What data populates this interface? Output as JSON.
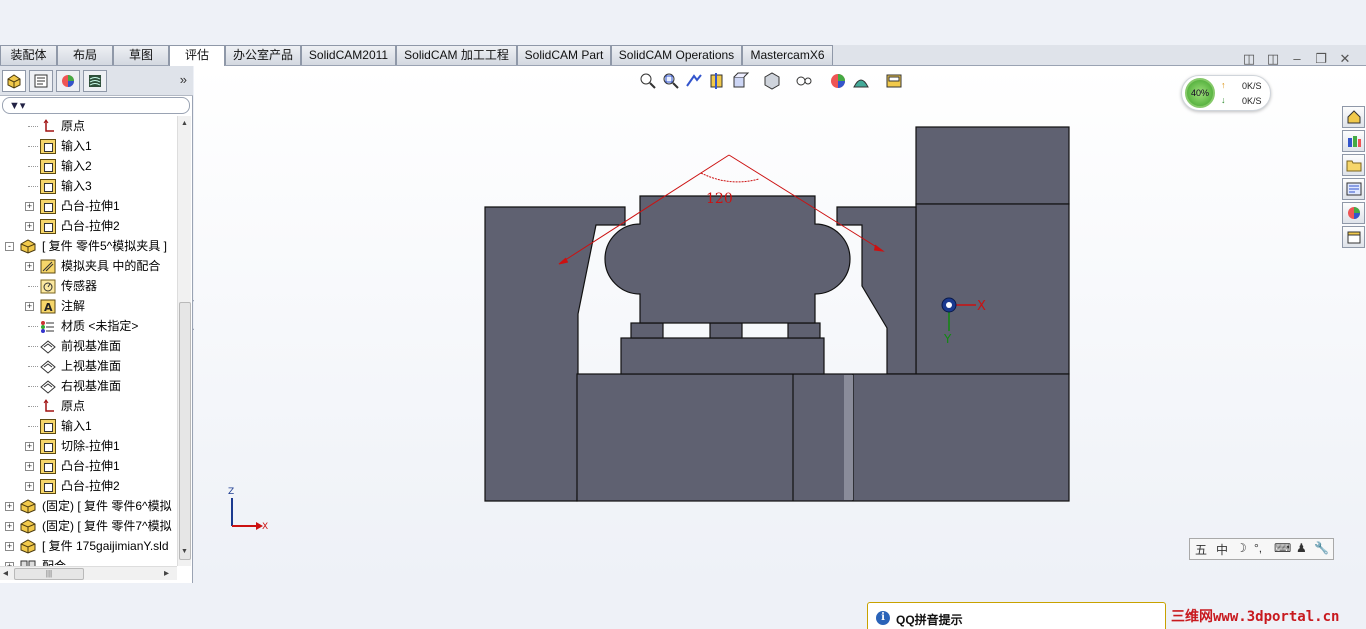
{
  "menu_tabs": [
    {
      "label": "装配体"
    },
    {
      "label": "布局"
    },
    {
      "label": "草图"
    },
    {
      "label": "评估"
    },
    {
      "label": "办公室产品"
    },
    {
      "label": "SolidCAM2011"
    },
    {
      "label": "SolidCAM 加工工程"
    },
    {
      "label": "SolidCAM Part"
    },
    {
      "label": "SolidCAM Operations"
    },
    {
      "label": "MastercamX6"
    }
  ],
  "active_tab": "评估",
  "tree": [
    {
      "label": "原点",
      "icon": "origin-icon",
      "level": 2
    },
    {
      "label": "输入1",
      "icon": "import-feature-icon",
      "level": 2
    },
    {
      "label": "输入2",
      "icon": "import-feature-icon",
      "level": 2
    },
    {
      "label": "输入3",
      "icon": "import-feature-icon",
      "level": 2
    },
    {
      "label": "凸台-拉伸1",
      "icon": "boss-extrude-icon",
      "level": 2,
      "expander": "+"
    },
    {
      "label": "凸台-拉伸2",
      "icon": "boss-extrude-icon",
      "level": 2,
      "expander": "+"
    },
    {
      "label": "[ 复件 零件5^模拟夹具 ]",
      "icon": "part-icon",
      "level": 1,
      "expander": "-"
    },
    {
      "label": "模拟夹具 中的配合",
      "icon": "mates-icon",
      "level": 2,
      "expander": "+"
    },
    {
      "label": "传感器",
      "icon": "sensor-icon",
      "level": 2
    },
    {
      "label": "注解",
      "icon": "annotation-icon",
      "level": 2,
      "expander": "+"
    },
    {
      "label": "材质 <未指定>",
      "icon": "material-icon",
      "level": 2
    },
    {
      "label": "前视基准面",
      "icon": "plane-icon",
      "level": 2
    },
    {
      "label": "上视基准面",
      "icon": "plane-icon",
      "level": 2
    },
    {
      "label": "右视基准面",
      "icon": "plane-icon",
      "level": 2
    },
    {
      "label": "原点",
      "icon": "origin-icon",
      "level": 2
    },
    {
      "label": "输入1",
      "icon": "import-feature-icon",
      "level": 2
    },
    {
      "label": "切除-拉伸1",
      "icon": "cut-extrude-icon",
      "level": 2,
      "expander": "+"
    },
    {
      "label": "凸台-拉伸1",
      "icon": "boss-extrude-icon",
      "level": 2,
      "expander": "+"
    },
    {
      "label": "凸台-拉伸2",
      "icon": "boss-extrude-icon",
      "level": 2,
      "expander": "+"
    },
    {
      "label": "(固定) [ 复件 零件6^模拟",
      "icon": "part-icon",
      "level": 0,
      "expander": "+"
    },
    {
      "label": "(固定) [ 复件 零件7^模拟",
      "icon": "part-icon",
      "level": 0,
      "expander": "+"
    },
    {
      "label": "[ 复件 175gaijimianY.sld",
      "icon": "part-icon",
      "level": 0,
      "expander": "+"
    },
    {
      "label": "配合",
      "icon": "mates-icon",
      "level": 0,
      "expander": "+"
    }
  ],
  "dimension": {
    "angle": "120"
  },
  "triad": {
    "x": "X",
    "y": "Y"
  },
  "axis_indicator": {
    "z": "Z",
    "x": "X"
  },
  "net_monitor": {
    "percent": "40%",
    "up": "0K/S",
    "down": "0K/S",
    "up_arrow": "↑",
    "down_arrow": "↓"
  },
  "ime_bar": {
    "mode": "中",
    "items": [
      "五",
      "中",
      "☽",
      "°,",
      "⌨",
      "♟",
      "🔧"
    ]
  },
  "qq_popup": {
    "title": "QQ拼音提示"
  },
  "watermark": "三维网www.3dportal.cn",
  "colors": {
    "part_fill": "#5f6171",
    "part_edge": "#111111",
    "dimension": "#cc1111",
    "accent_blue": "#1b3a8f"
  }
}
